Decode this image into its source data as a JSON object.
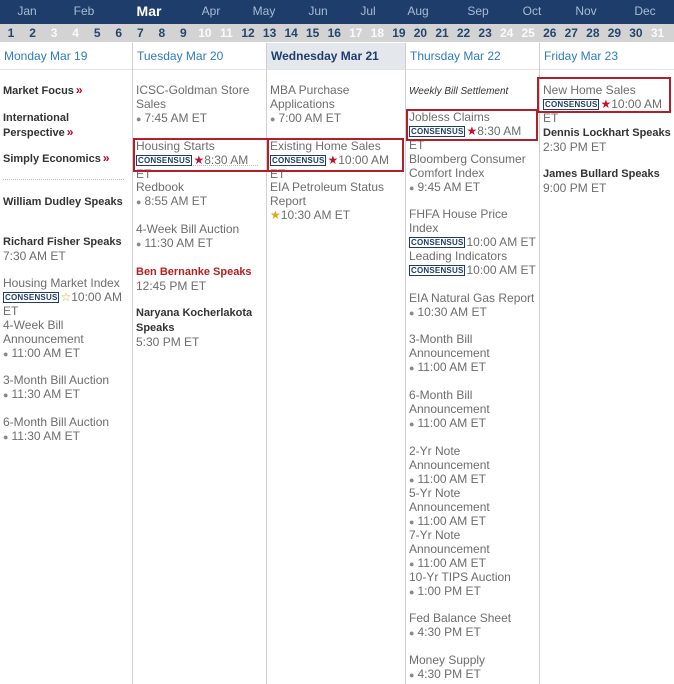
{
  "months": [
    "Jan",
    "Feb",
    "Mar",
    "Apr",
    "May",
    "Jun",
    "Jul",
    "Aug",
    "Sep",
    "Oct",
    "Nov",
    "Dec"
  ],
  "active_month": "Mar",
  "days": [
    "1",
    "2",
    "3",
    "4",
    "5",
    "6",
    "7",
    "8",
    "9",
    "10",
    "11",
    "12",
    "13",
    "14",
    "15",
    "16",
    "17",
    "18",
    "19",
    "20",
    "21",
    "22",
    "23",
    "24",
    "25",
    "26",
    "27",
    "28",
    "29",
    "30",
    "31"
  ],
  "columns": [
    {
      "header": "Monday Mar 19",
      "events": [
        {
          "name": "Market Focus",
          "raquo": "»",
          "style": "bold"
        },
        {
          "name": "International Perspective",
          "raquo": "»",
          "style": "bold"
        },
        {
          "name": "Simply Economics",
          "raquo": "»",
          "style": "bold"
        },
        {
          "name": "William Dudley Speaks",
          "style": "bold"
        },
        {
          "name": "Richard Fisher Speaks",
          "style": "bold",
          "time": "7:30 AM ET"
        },
        {
          "name": "Housing Market Index",
          "style": "link",
          "badge": "CONSENSUS",
          "star": "☆",
          "star_color": "gold",
          "time": "10:00 AM ET"
        },
        {
          "name": "4-Week Bill Announcement",
          "style": "link",
          "bullet": "●",
          "time": "11:00 AM ET"
        },
        {
          "name": "3-Month Bill Auction",
          "style": "link",
          "bullet": "●",
          "time": "11:30 AM ET"
        },
        {
          "name": "6-Month Bill Auction",
          "style": "link",
          "bullet": "●",
          "time": "11:30 AM ET"
        }
      ]
    },
    {
      "header": "Tuesday Mar 20",
      "events": [
        {
          "name": "ICSC-Goldman Store Sales",
          "style": "link",
          "bullet": "●",
          "time": "7:45 AM ET"
        },
        {
          "name": "Housing Starts",
          "style": "link",
          "badge": "CONSENSUS",
          "star": "★",
          "star_color": "red",
          "time": "8:30 AM ET"
        },
        {
          "name": "Redbook",
          "style": "link",
          "bullet": "●",
          "time": "8:55 AM ET"
        },
        {
          "name": "4-Week Bill Auction",
          "style": "link",
          "bullet": "●",
          "time": "11:30 AM ET"
        },
        {
          "name": "Ben Bernanke Speaks",
          "style": "red",
          "time": "12:45 PM ET"
        },
        {
          "name": "Naryana Kocherlakota Speaks",
          "style": "bold",
          "time": "5:30 PM ET"
        }
      ]
    },
    {
      "header": "Wednesday Mar 21",
      "events": [
        {
          "name": "MBA Purchase Applications",
          "style": "link",
          "bullet": "●",
          "time": "7:00 AM ET"
        },
        {
          "name": "Existing Home Sales",
          "style": "link",
          "badge": "CONSENSUS",
          "star": "★",
          "star_color": "red",
          "time": "10:00 AM ET"
        },
        {
          "name": "EIA Petroleum Status Report",
          "style": "link",
          "star": "★",
          "star_color": "gold",
          "time": "10:30 AM ET"
        }
      ]
    },
    {
      "header": "Thursday Mar 22",
      "events": [
        {
          "name": "Weekly Bill Settlement",
          "style": "italic"
        },
        {
          "name": "Jobless Claims",
          "style": "link",
          "badge": "CONSENSUS",
          "star": "★",
          "star_color": "red",
          "time": "8:30 AM ET"
        },
        {
          "name": "Bloomberg Consumer Comfort Index",
          "style": "link",
          "bullet": "●",
          "time": "9:45 AM ET"
        },
        {
          "name": "FHFA House Price Index",
          "style": "link",
          "badge": "CONSENSUS",
          "time": "10:00 AM ET"
        },
        {
          "name": "Leading Indicators",
          "style": "link",
          "badge": "CONSENSUS",
          "time": "10:00 AM ET"
        },
        {
          "name": "EIA Natural Gas Report",
          "style": "link",
          "bullet": "●",
          "time": "10:30 AM ET"
        },
        {
          "name": "3-Month Bill Announcement",
          "style": "link",
          "bullet": "●",
          "time": "11:00 AM ET"
        },
        {
          "name": "6-Month Bill Announcement",
          "style": "link",
          "bullet": "●",
          "time": "11:00 AM ET"
        },
        {
          "name": "2-Yr Note Announcement",
          "style": "link",
          "bullet": "●",
          "time": "11:00 AM ET"
        },
        {
          "name": "5-Yr Note Announcement",
          "style": "link",
          "bullet": "●",
          "time": "11:00 AM ET"
        },
        {
          "name": "7-Yr Note Announcement",
          "style": "link",
          "bullet": "●",
          "time": "11:00 AM ET"
        },
        {
          "name": "10-Yr TIPS Auction",
          "style": "link",
          "bullet": "●",
          "time": "1:00 PM ET"
        },
        {
          "name": "Fed Balance Sheet",
          "style": "link",
          "bullet": "●",
          "time": "4:30 PM ET"
        },
        {
          "name": "Money Supply",
          "style": "link",
          "bullet": "●",
          "time": "4:30 PM ET"
        }
      ]
    },
    {
      "header": "Friday Mar 23",
      "events": [
        {
          "name": "New Home Sales",
          "style": "link",
          "badge": "CONSENSUS",
          "star": "★",
          "star_color": "red",
          "time": "10:00 AM ET"
        },
        {
          "name": "Dennis Lockhart Speaks",
          "style": "bold",
          "time": "2:30 PM ET"
        },
        {
          "name": "James Bullard Speaks",
          "style": "bold",
          "time": "9:00 PM ET"
        }
      ]
    }
  ],
  "colors": {
    "header_bg": "#1e3d6b",
    "highlight": "#b41e2a",
    "star_red": "#c8102e",
    "star_gold": "#e8a317"
  }
}
